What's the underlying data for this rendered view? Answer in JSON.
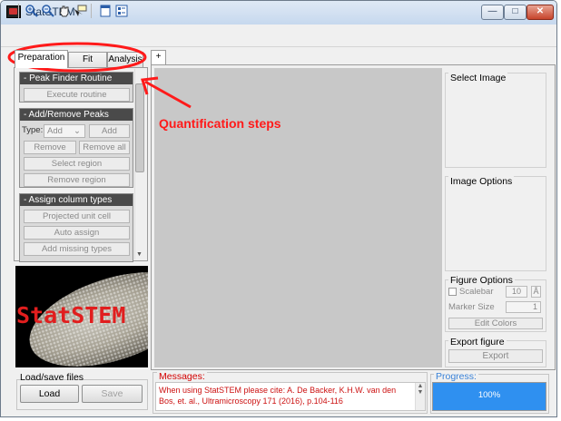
{
  "window": {
    "title": "StatSTEM",
    "min_glyph": "—",
    "max_glyph": "□",
    "close_glyph": "✕"
  },
  "toolbar": {
    "icons": [
      "zoom-in-icon",
      "zoom-out-icon",
      "pan-icon",
      "datacursor-icon",
      "panel-icon",
      "layout-icon"
    ]
  },
  "tabs": {
    "preparation": "Preparation",
    "fit_model": "Fit Model",
    "analysis": "Analysis",
    "plus": "+"
  },
  "peak_finder": {
    "title": "- Peak Finder Routine",
    "execute": "Execute routine"
  },
  "add_remove": {
    "title": "- Add/Remove Peaks",
    "type_label": "Type:",
    "type_value": "Add",
    "add": "Add",
    "remove": "Remove",
    "remove_all": "Remove all",
    "select_region": "Select region",
    "remove_region": "Remove region"
  },
  "assign": {
    "title": "- Assign column types",
    "projected_unit_cell": "Projected unit cell",
    "auto_assign": "Auto assign",
    "add_missing_types": "Add missing types"
  },
  "preview": {
    "watermark": "StatSTEM"
  },
  "load_save": {
    "label": "Load/save files",
    "load": "Load",
    "save": "Save"
  },
  "right": {
    "select_image": "Select Image",
    "image_options": "Image Options",
    "figure_options": "Figure Options",
    "scalebar_label": "Scalebar",
    "scalebar_value": "10",
    "scalebar_unit": "Å",
    "marker_size_label": "Marker Size",
    "marker_size_value": "1",
    "edit_colors": "Edit Colors",
    "export_figure": "Export figure",
    "export": "Export"
  },
  "messages": {
    "label": "Messages:",
    "text": "When using StatSTEM please cite: A. De Backer, K.H.W. van den Bos, et. al., Ultramicroscopy 171 (2016), p.104-116"
  },
  "progress": {
    "label": "Progress:",
    "text": "100%",
    "fraction": 1.0
  },
  "annotation": {
    "text": "Quantification steps",
    "color": "#ff1a1a"
  },
  "colors": {
    "section_header": "#4a4a4a",
    "progress_fill": "#2f90f0",
    "message_text": "#cc1111"
  }
}
